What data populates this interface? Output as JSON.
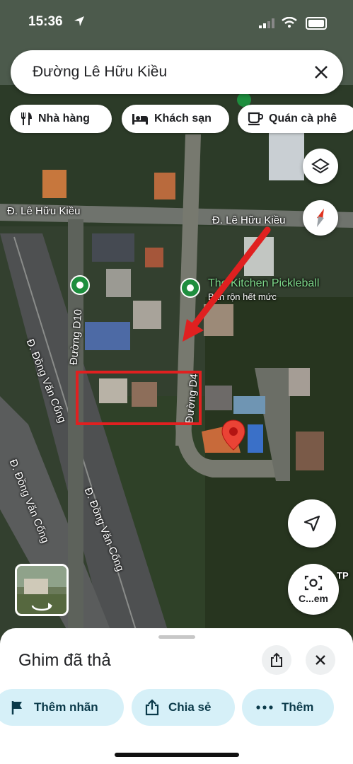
{
  "status_bar": {
    "time": "15:36"
  },
  "search": {
    "query": "Đường Lê Hữu Kiều"
  },
  "chips": [
    {
      "label": "Nhà hàng",
      "icon": "restaurant-icon"
    },
    {
      "label": "Khách sạn",
      "icon": "hotel-icon"
    },
    {
      "label": "Quán cà phê",
      "icon": "coffee-icon"
    }
  ],
  "map": {
    "road_labels": {
      "le_huu_kieu_west": "Đ. Lê Hữu Kiều",
      "le_huu_kieu_east": "Đ. Lê Hữu Kiều",
      "duong_d10": "Đường D10",
      "duong_d4": "Đường D4",
      "dong_van_cong_1": "Đ. Đồng Văn Cống",
      "dong_van_cong_2": "Đ. Đồng Văn Cống",
      "dong_van_cong_3": "Đ. Đồng Văn Cống"
    },
    "place": {
      "name": "The Kitchen Pickleball",
      "subtitle": "Bận rộn hết mức"
    },
    "camera_label": "C...em",
    "edge_text": "TP"
  },
  "sheet": {
    "title": "Ghim đã thả",
    "actions": [
      {
        "label": "Thêm nhãn",
        "icon": "flag-icon"
      },
      {
        "label": "Chia sẻ",
        "icon": "share-icon"
      },
      {
        "label": "Thêm",
        "icon": "more-icon"
      }
    ]
  },
  "colors": {
    "pin": "#ea4335",
    "accent_chip": "#d6f0f8",
    "place_marker": "#1e8e3e",
    "annotation": "#e02020"
  }
}
